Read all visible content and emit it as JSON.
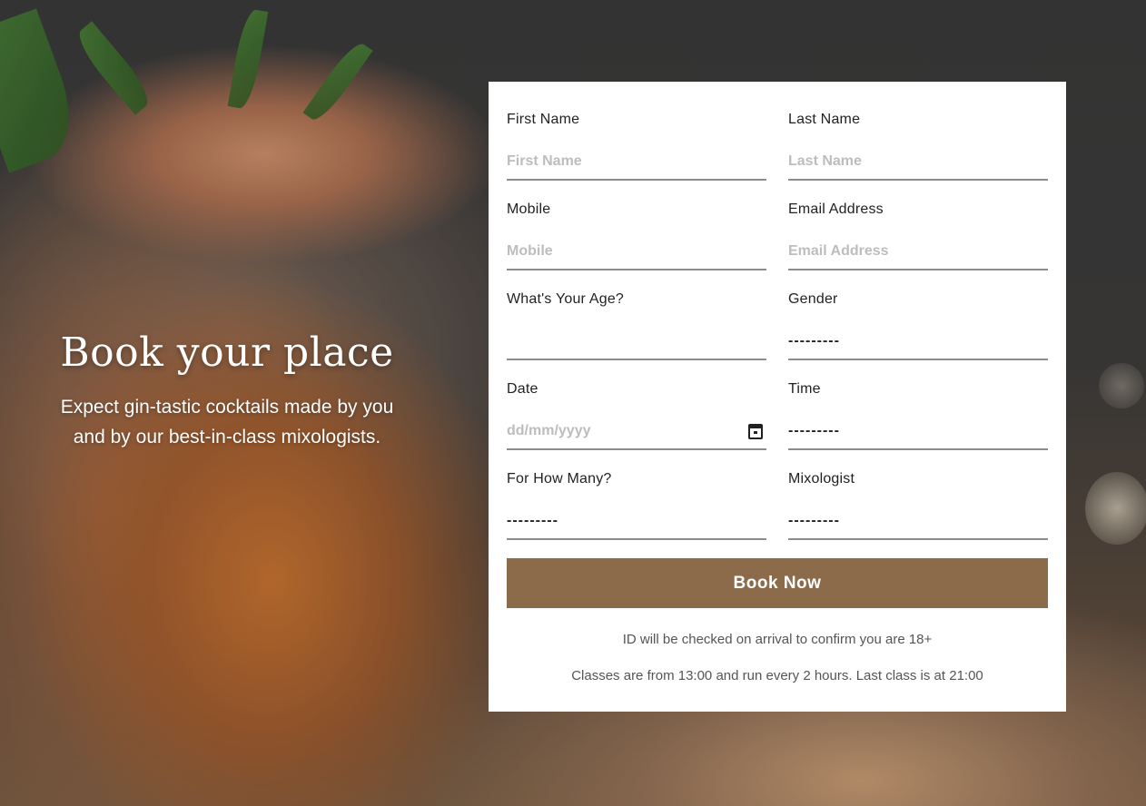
{
  "hero": {
    "title": "Book your place",
    "subtitle_line1": "Expect gin-tastic cocktails made by you",
    "subtitle_line2": "and by our best-in-class mixologists."
  },
  "form": {
    "first_name": {
      "label": "First Name",
      "placeholder": "First Name"
    },
    "last_name": {
      "label": "Last Name",
      "placeholder": "Last Name"
    },
    "mobile": {
      "label": "Mobile",
      "placeholder": "Mobile"
    },
    "email": {
      "label": "Email Address",
      "placeholder": "Email Address"
    },
    "age": {
      "label": "What's Your Age?",
      "value": ""
    },
    "gender": {
      "label": "Gender",
      "value": "---------"
    },
    "date": {
      "label": "Date",
      "placeholder": "dd/mm/yyyy"
    },
    "time": {
      "label": "Time",
      "value": "---------"
    },
    "how_many": {
      "label": "For How Many?",
      "value": "---------"
    },
    "mixologist": {
      "label": "Mixologist",
      "value": "---------"
    },
    "submit_label": "Book Now"
  },
  "notes": {
    "id_check": "ID will be checked on arrival to confirm you are 18+",
    "classes": "Classes are from 13:00 and run every 2 hours. Last class is at 21:00"
  },
  "colors": {
    "button_bg": "#8b6b4a",
    "card_bg": "#ffffff",
    "underline": "#8c8c8c"
  }
}
